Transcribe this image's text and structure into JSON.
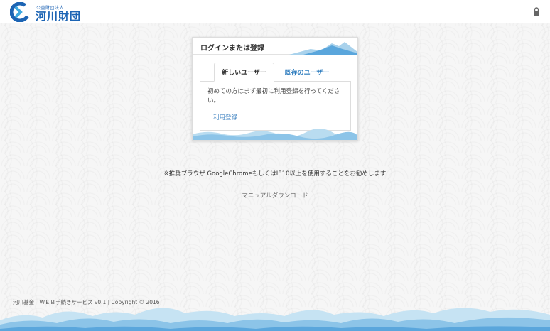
{
  "header": {
    "logo_subtitle": "公益財団法人",
    "logo_title": "河川財団",
    "lock_icon": "lock-icon"
  },
  "login_card": {
    "title": "ログインまたは登録",
    "tabs": [
      {
        "label": "新しいユーザー",
        "active": true
      },
      {
        "label": "既存のユーザー",
        "active": false
      }
    ],
    "panel_text": "初めての方はまず最初に利用登録を行ってください。",
    "register_link": "利用登録"
  },
  "notice": "※推奨ブラウザ GoogleChromeもしくはIE10以上を使用することをお勧めします",
  "manual_link": "マニュアルダウンロード",
  "footer": {
    "text": "河川基金　ＷＥＢ手続きサービス v0.1 | Copyright © 2016"
  },
  "colors": {
    "brand_blue": "#1c64b4",
    "link_blue": "#2a7abd",
    "wave_light": "#b9dcf0",
    "wave_mid": "#8cc4e8",
    "wave_dark": "#5aa6dc"
  }
}
